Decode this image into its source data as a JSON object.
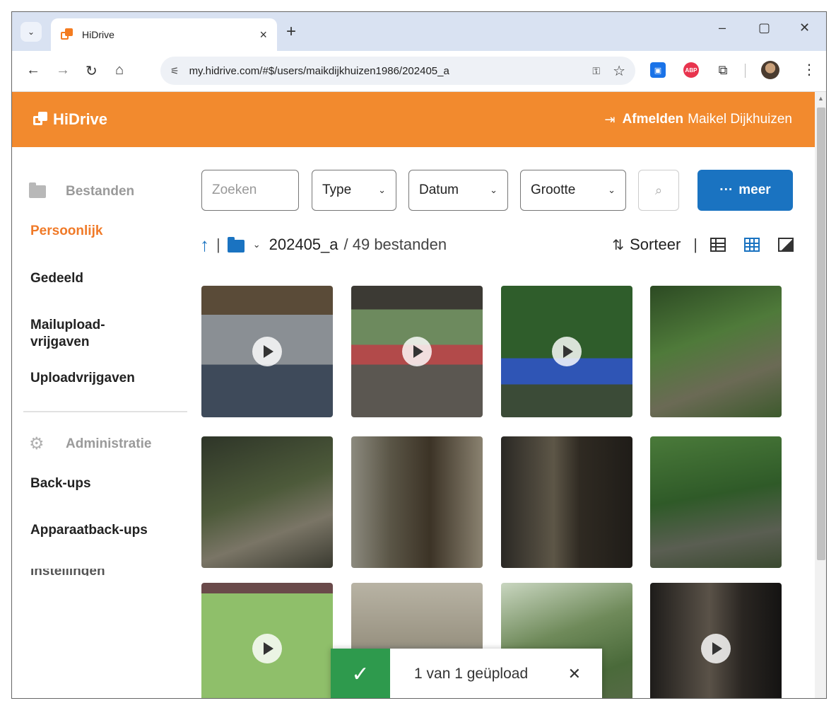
{
  "browser": {
    "tab_title": "HiDrive",
    "tab_close": "×",
    "new_tab": "+",
    "url": "my.hidrive.com/#$/users/maikdijkhuizen1986/202405_a",
    "window_controls": [
      "–",
      "▢",
      "✕"
    ],
    "ext_abp": "ABP"
  },
  "app": {
    "brand": "HiDrive",
    "logout_label": "Afmelden",
    "user_name": "Maikel Dijkhuizen",
    "accent_color": "#f28a2e",
    "primary_color": "#1a73c1"
  },
  "sidebar": {
    "files_header": "Bestanden",
    "items": [
      {
        "label": "Persoonlijk",
        "active": true
      },
      {
        "label": "Gedeeld"
      },
      {
        "label": "Mailupload-\nvrijgaven"
      },
      {
        "label": "Uploadvrijgaven"
      }
    ],
    "admin_header": "Administratie",
    "admin_items": [
      {
        "label": "Back-ups"
      },
      {
        "label": "Apparaatback-ups"
      },
      {
        "label": "Instellingen"
      }
    ]
  },
  "filters": {
    "search_placeholder": "Zoeken",
    "type_label": "Type",
    "date_label": "Datum",
    "size_label": "Grootte",
    "more_label": "meer",
    "more_dots": "···"
  },
  "path": {
    "folder_name": "202405_a",
    "count_text": "/ 49 bestanden",
    "sort_label": "Sorteer"
  },
  "grid": {
    "items": [
      {
        "kind": "video",
        "bg": "linear-gradient(180deg,#5a4b38 0 22%,#8a8f94 22% 60%,#3e4a5a 60% 100%)"
      },
      {
        "kind": "video",
        "bg": "linear-gradient(180deg,#3c3a34 0 18%,#6d8a5e 18% 45%,#b24a4a 45% 60%,#5b5751 60% 100%)"
      },
      {
        "kind": "video",
        "bg": "linear-gradient(180deg,#2f5d2b 0 55%,#2f55b5 55% 75%,#3b4b37 75% 100%)"
      },
      {
        "kind": "image",
        "bg": "linear-gradient(160deg,#2c4a23 0%,#4f7a3a 40%,#6b6a55 70%,#3d5a2d 100%)"
      },
      {
        "kind": "image",
        "bg": "linear-gradient(160deg,#2e3528 0%,#4d5a3a 45%,#7a7566 70%,#3a3a30 100%)"
      },
      {
        "kind": "image",
        "bg": "linear-gradient(90deg,#8c8a7e 0%,#5a5546 30%,#3c3326 60%,#8a8270 100%)"
      },
      {
        "kind": "image",
        "bg": "linear-gradient(90deg,#2a2824 0%,#5d5647 40%,#2f2a22 60%,#1f1c18 100%)"
      },
      {
        "kind": "image",
        "bg": "linear-gradient(170deg,#4a7a3a 0%,#2f5a28 45%,#5a5e52 75%,#3b4a30 100%)"
      },
      {
        "kind": "video",
        "bg": "linear-gradient(180deg,#6a4a4a 0 8%,#8fbf6a 8% 100%)"
      },
      {
        "kind": "image",
        "bg": "linear-gradient(180deg,#b8b3a4 0%,#9a9483 45%,#5e6a7a 75%,#4a4a42 100%)"
      },
      {
        "kind": "image",
        "bg": "linear-gradient(160deg,#c9d6c0 0%,#6f8a5a 40%,#4a6a3a 70%,#5a6a4a 100%)"
      },
      {
        "kind": "video",
        "bg": "linear-gradient(90deg,#1e1c1a 0%,#5a5248 45%,#2a2622 70%,#141312 100%)"
      }
    ]
  },
  "toast": {
    "message": "1 van 1 geüpload",
    "close": "✕",
    "check": "✓"
  }
}
